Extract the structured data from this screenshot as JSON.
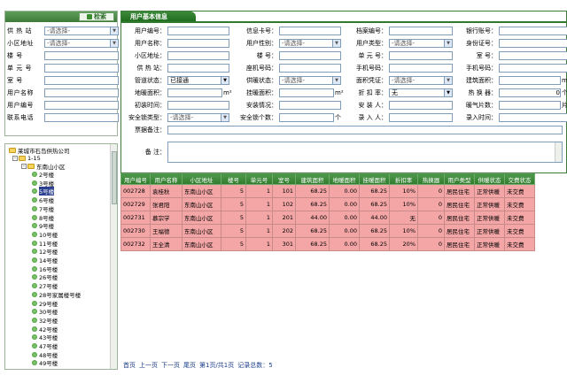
{
  "filter": {
    "search_label": "检索",
    "rows": [
      {
        "label": "供 热 站",
        "type": "select",
        "value": "-请选择-"
      },
      {
        "label": "小区地址",
        "type": "select",
        "value": "-请选择-"
      },
      {
        "label": "楼  号",
        "type": "input",
        "value": ""
      },
      {
        "label": "单 元 号",
        "type": "input",
        "value": ""
      },
      {
        "label": "室  号",
        "type": "input",
        "value": ""
      },
      {
        "label": "用户名称",
        "type": "input",
        "value": ""
      },
      {
        "label": "用户编号",
        "type": "input",
        "value": ""
      },
      {
        "label": "联系电话",
        "type": "input",
        "value": ""
      }
    ]
  },
  "tree": {
    "root": "莱城市石岛供热公司",
    "station": "1-15",
    "community": "东南山小区",
    "buildings": [
      "2号楼",
      "3号楼",
      "5号楼",
      "6号楼",
      "7号楼",
      "8号楼",
      "9号楼",
      "10号楼",
      "11号楼",
      "12号楼",
      "14号楼",
      "16号楼",
      "26号楼",
      "27号楼",
      "28号家属楼号楼",
      "29号楼",
      "30号楼",
      "32号楼",
      "42号楼",
      "43号楼",
      "47号楼",
      "48号楼",
      "49号楼"
    ],
    "selected": "5号楼"
  },
  "info": {
    "title": "用户基本信息",
    "select_placeholder": "-请选择-",
    "fields": {
      "user_no": "用户编号：",
      "card_no": "信息卡号：",
      "file_no": "档案编号：",
      "bank_no": "银行账号：",
      "user_name": "用户名称：",
      "gender": "用户性别：",
      "user_type": "用户类型：",
      "id_no": "身份证号：",
      "community": "小区地址：",
      "building": "楼    号：",
      "unit": "单 元 号：",
      "room": "室    号：",
      "station": "供 热 站：",
      "seat_phone": "座机号码：",
      "mobile": "手机号码：",
      "mobile2": "手机号码：",
      "pipe_status": "管道状态：",
      "heat_status": "供暖状态：",
      "area_cert": "面积凭证：",
      "build_area": "建筑面积：",
      "floor_heat_area": "地暖面积：",
      "radiator_area": "挂暖面积：",
      "discount": "折 扣 率：",
      "heater": "热 换 器：",
      "first_date": "初装时间：",
      "install_info": "安装情况：",
      "installer": "安 装 人：",
      "radiator_pieces": "暖气片数：",
      "lock_type": "安全锁类型：",
      "lock_count": "安全锁个数：",
      "entry_person": "录 入 人：",
      "entry_time": "录入时间：",
      "ticket_note": "票据备注：",
      "remark": "备    注："
    },
    "values": {
      "pipe_status": "已接通",
      "heat_status": "-请选择-",
      "area_cert": "-请选择-",
      "discount": "无",
      "heater": "0",
      "lock_type": "-请选择-"
    },
    "units": {
      "sqm": "m²",
      "pieces": "片",
      "count": "个"
    }
  },
  "table": {
    "headers": [
      "用户编号",
      "用户名称",
      "小区地址",
      "楼号",
      "单元号",
      "室号",
      "建筑面积",
      "地暖面积",
      "挂暖面积",
      "折扣率",
      "热换器",
      "用户类型",
      "供暖状态",
      "交费状态"
    ],
    "rows": [
      [
        "002728",
        "袁桂秋",
        "东南山小区",
        "5",
        "1",
        "101",
        "68.25",
        "0.00",
        "68.25",
        "10%",
        "0",
        "居民住宅",
        "正常供暖",
        "未交费"
      ],
      [
        "002729",
        "张君阳",
        "东南山小区",
        "5",
        "1",
        "102",
        "68.25",
        "0.00",
        "68.25",
        "10%",
        "0",
        "居民住宅",
        "正常供暖",
        "未交费"
      ],
      [
        "002731",
        "慕宗学",
        "东南山小区",
        "5",
        "1",
        "201",
        "44.00",
        "0.00",
        "44.00",
        "无",
        "0",
        "居民住宅",
        "正常供暖",
        "未交费"
      ],
      [
        "002730",
        "王福德",
        "东南山小区",
        "5",
        "1",
        "202",
        "68.25",
        "0.00",
        "68.25",
        "10%",
        "0",
        "居民住宅",
        "正常供暖",
        "未交费"
      ],
      [
        "002732",
        "王全清",
        "东南山小区",
        "5",
        "1",
        "301",
        "68.25",
        "0.00",
        "68.25",
        "20%",
        "0",
        "居民住宅",
        "正常供暖",
        "未交费"
      ]
    ]
  },
  "pager": {
    "first": "首页",
    "prev": "上一页",
    "next": "下一页",
    "last": "尾页",
    "page_info": "第1页/共1页",
    "total": "记录总数：5"
  },
  "colors": {
    "header_green": "#2f7a2c",
    "row_pink": "#f4a6a6",
    "selected_node": "#2a3f8f"
  }
}
